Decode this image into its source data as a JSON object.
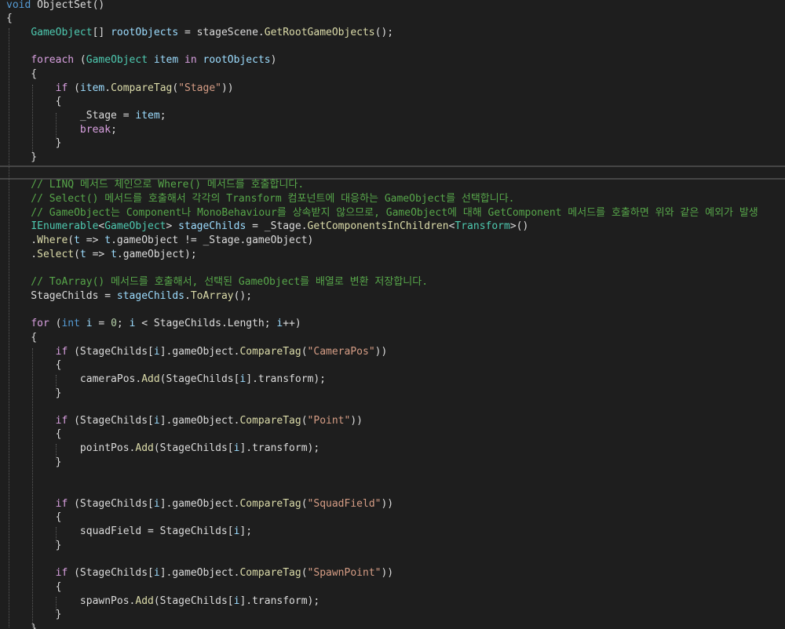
{
  "editor": {
    "language": "C#",
    "colors": {
      "background": "#1e1e1e",
      "keyword": "#569cd6",
      "control": "#d8a0df",
      "type": "#4ec9b0",
      "method": "#dcdcaa",
      "string": "#d69d85",
      "number": "#b5cea8",
      "local": "#9cdcfe",
      "comment": "#57a64a",
      "plain": "#dcdcdc"
    },
    "lines": [
      {
        "tokens": [
          {
            "t": "void",
            "c": "kw"
          },
          {
            "t": " ObjectSet()",
            "c": "txt"
          }
        ]
      },
      {
        "tokens": [
          {
            "t": "{",
            "c": "txt"
          }
        ]
      },
      {
        "tokens": [
          {
            "t": "    ",
            "c": "txt"
          },
          {
            "t": "GameObject",
            "c": "type"
          },
          {
            "t": "[] ",
            "c": "txt"
          },
          {
            "t": "rootObjects",
            "c": "var"
          },
          {
            "t": " = stageScene.",
            "c": "txt"
          },
          {
            "t": "GetRootGameObjects",
            "c": "fn"
          },
          {
            "t": "();",
            "c": "txt"
          }
        ]
      },
      {
        "tokens": []
      },
      {
        "tokens": [
          {
            "t": "    ",
            "c": "txt"
          },
          {
            "t": "foreach",
            "c": "ctl"
          },
          {
            "t": " (",
            "c": "txt"
          },
          {
            "t": "GameObject",
            "c": "type"
          },
          {
            "t": " ",
            "c": "txt"
          },
          {
            "t": "item",
            "c": "var"
          },
          {
            "t": " ",
            "c": "txt"
          },
          {
            "t": "in",
            "c": "ctl"
          },
          {
            "t": " ",
            "c": "txt"
          },
          {
            "t": "rootObjects",
            "c": "var"
          },
          {
            "t": ")",
            "c": "txt"
          }
        ]
      },
      {
        "tokens": [
          {
            "t": "    {",
            "c": "txt"
          }
        ]
      },
      {
        "tokens": [
          {
            "t": "        ",
            "c": "txt"
          },
          {
            "t": "if",
            "c": "ctl"
          },
          {
            "t": " (",
            "c": "txt"
          },
          {
            "t": "item",
            "c": "var"
          },
          {
            "t": ".",
            "c": "txt"
          },
          {
            "t": "CompareTag",
            "c": "fn"
          },
          {
            "t": "(",
            "c": "txt"
          },
          {
            "t": "\"Stage\"",
            "c": "str"
          },
          {
            "t": "))",
            "c": "txt"
          }
        ]
      },
      {
        "tokens": [
          {
            "t": "        {",
            "c": "txt"
          }
        ]
      },
      {
        "tokens": [
          {
            "t": "            _Stage = ",
            "c": "txt"
          },
          {
            "t": "item",
            "c": "var"
          },
          {
            "t": ";",
            "c": "txt"
          }
        ]
      },
      {
        "tokens": [
          {
            "t": "            ",
            "c": "txt"
          },
          {
            "t": "break",
            "c": "ctl"
          },
          {
            "t": ";",
            "c": "txt"
          }
        ]
      },
      {
        "tokens": [
          {
            "t": "        }",
            "c": "txt"
          }
        ]
      },
      {
        "tokens": [
          {
            "t": "    }",
            "c": "txt"
          }
        ]
      },
      {
        "tokens": []
      },
      {
        "tokens": [
          {
            "t": "    // LINQ 메서드 체인으로 Where() 메서드를 호출합니다.",
            "c": "com"
          }
        ]
      },
      {
        "tokens": [
          {
            "t": "    // Select() 메서드를 호출해서 각각의 Transform 컴포넌트에 대응하는 GameObject를 선택합니다.",
            "c": "com"
          }
        ]
      },
      {
        "tokens": [
          {
            "t": "    // GameObject는 Component나 MonoBehaviour를 상속받지 않으므로, GameObject에 대해 GetComponent 메서드를 호출하면 위와 같은 예외가 발생",
            "c": "com"
          }
        ]
      },
      {
        "tokens": [
          {
            "t": "    ",
            "c": "txt"
          },
          {
            "t": "IEnumerable",
            "c": "type"
          },
          {
            "t": "<",
            "c": "txt"
          },
          {
            "t": "GameObject",
            "c": "type"
          },
          {
            "t": "> ",
            "c": "txt"
          },
          {
            "t": "stageChilds",
            "c": "var"
          },
          {
            "t": " = _Stage.",
            "c": "txt"
          },
          {
            "t": "GetComponentsInChildren",
            "c": "fn"
          },
          {
            "t": "<",
            "c": "txt"
          },
          {
            "t": "Transform",
            "c": "type"
          },
          {
            "t": ">()",
            "c": "txt"
          }
        ]
      },
      {
        "tokens": [
          {
            "t": "    .",
            "c": "txt"
          },
          {
            "t": "Where",
            "c": "fn"
          },
          {
            "t": "(",
            "c": "txt"
          },
          {
            "t": "t",
            "c": "var"
          },
          {
            "t": " => ",
            "c": "txt"
          },
          {
            "t": "t",
            "c": "var"
          },
          {
            "t": ".gameObject != _Stage.gameObject)",
            "c": "txt"
          }
        ]
      },
      {
        "tokens": [
          {
            "t": "    .",
            "c": "txt"
          },
          {
            "t": "Select",
            "c": "fn"
          },
          {
            "t": "(",
            "c": "txt"
          },
          {
            "t": "t",
            "c": "var"
          },
          {
            "t": " => ",
            "c": "txt"
          },
          {
            "t": "t",
            "c": "var"
          },
          {
            "t": ".gameObject);",
            "c": "txt"
          }
        ]
      },
      {
        "tokens": []
      },
      {
        "tokens": [
          {
            "t": "    // ToArray() 메서드를 호출해서, 선택된 GameObject를 배열로 변환 저장합니다.",
            "c": "com"
          }
        ]
      },
      {
        "tokens": [
          {
            "t": "    StageChilds = ",
            "c": "txt"
          },
          {
            "t": "stageChilds",
            "c": "var"
          },
          {
            "t": ".",
            "c": "txt"
          },
          {
            "t": "ToArray",
            "c": "fn"
          },
          {
            "t": "();",
            "c": "txt"
          }
        ]
      },
      {
        "tokens": []
      },
      {
        "tokens": [
          {
            "t": "    ",
            "c": "txt"
          },
          {
            "t": "for",
            "c": "ctl"
          },
          {
            "t": " (",
            "c": "txt"
          },
          {
            "t": "int",
            "c": "kw"
          },
          {
            "t": " ",
            "c": "txt"
          },
          {
            "t": "i",
            "c": "var"
          },
          {
            "t": " = ",
            "c": "txt"
          },
          {
            "t": "0",
            "c": "num"
          },
          {
            "t": "; ",
            "c": "txt"
          },
          {
            "t": "i",
            "c": "var"
          },
          {
            "t": " < StageChilds.Length; ",
            "c": "txt"
          },
          {
            "t": "i",
            "c": "var"
          },
          {
            "t": "++)",
            "c": "txt"
          }
        ]
      },
      {
        "tokens": [
          {
            "t": "    {",
            "c": "txt"
          }
        ]
      },
      {
        "tokens": [
          {
            "t": "        ",
            "c": "txt"
          },
          {
            "t": "if",
            "c": "ctl"
          },
          {
            "t": " (StageChilds[",
            "c": "txt"
          },
          {
            "t": "i",
            "c": "var"
          },
          {
            "t": "].gameObject.",
            "c": "txt"
          },
          {
            "t": "CompareTag",
            "c": "fn"
          },
          {
            "t": "(",
            "c": "txt"
          },
          {
            "t": "\"CameraPos\"",
            "c": "str"
          },
          {
            "t": "))",
            "c": "txt"
          }
        ]
      },
      {
        "tokens": [
          {
            "t": "        {",
            "c": "txt"
          }
        ]
      },
      {
        "tokens": [
          {
            "t": "            cameraPos.",
            "c": "txt"
          },
          {
            "t": "Add",
            "c": "fn"
          },
          {
            "t": "(StageChilds[",
            "c": "txt"
          },
          {
            "t": "i",
            "c": "var"
          },
          {
            "t": "].transform);",
            "c": "txt"
          }
        ]
      },
      {
        "tokens": [
          {
            "t": "        }",
            "c": "txt"
          }
        ]
      },
      {
        "tokens": []
      },
      {
        "tokens": [
          {
            "t": "        ",
            "c": "txt"
          },
          {
            "t": "if",
            "c": "ctl"
          },
          {
            "t": " (StageChilds[",
            "c": "txt"
          },
          {
            "t": "i",
            "c": "var"
          },
          {
            "t": "].gameObject.",
            "c": "txt"
          },
          {
            "t": "CompareTag",
            "c": "fn"
          },
          {
            "t": "(",
            "c": "txt"
          },
          {
            "t": "\"Point\"",
            "c": "str"
          },
          {
            "t": "))",
            "c": "txt"
          }
        ]
      },
      {
        "tokens": [
          {
            "t": "        {",
            "c": "txt"
          }
        ]
      },
      {
        "tokens": [
          {
            "t": "            pointPos.",
            "c": "txt"
          },
          {
            "t": "Add",
            "c": "fn"
          },
          {
            "t": "(StageChilds[",
            "c": "txt"
          },
          {
            "t": "i",
            "c": "var"
          },
          {
            "t": "].transform);",
            "c": "txt"
          }
        ]
      },
      {
        "tokens": [
          {
            "t": "        }",
            "c": "txt"
          }
        ]
      },
      {
        "tokens": []
      },
      {
        "tokens": []
      },
      {
        "tokens": [
          {
            "t": "        ",
            "c": "txt"
          },
          {
            "t": "if",
            "c": "ctl"
          },
          {
            "t": " (StageChilds[",
            "c": "txt"
          },
          {
            "t": "i",
            "c": "var"
          },
          {
            "t": "].gameObject.",
            "c": "txt"
          },
          {
            "t": "CompareTag",
            "c": "fn"
          },
          {
            "t": "(",
            "c": "txt"
          },
          {
            "t": "\"SquadField\"",
            "c": "str"
          },
          {
            "t": "))",
            "c": "txt"
          }
        ]
      },
      {
        "tokens": [
          {
            "t": "        {",
            "c": "txt"
          }
        ]
      },
      {
        "tokens": [
          {
            "t": "            squadField = StageChilds[",
            "c": "txt"
          },
          {
            "t": "i",
            "c": "var"
          },
          {
            "t": "];",
            "c": "txt"
          }
        ]
      },
      {
        "tokens": [
          {
            "t": "        }",
            "c": "txt"
          }
        ]
      },
      {
        "tokens": []
      },
      {
        "tokens": [
          {
            "t": "        ",
            "c": "txt"
          },
          {
            "t": "if",
            "c": "ctl"
          },
          {
            "t": " (StageChilds[",
            "c": "txt"
          },
          {
            "t": "i",
            "c": "var"
          },
          {
            "t": "].gameObject.",
            "c": "txt"
          },
          {
            "t": "CompareTag",
            "c": "fn"
          },
          {
            "t": "(",
            "c": "txt"
          },
          {
            "t": "\"SpawnPoint\"",
            "c": "str"
          },
          {
            "t": "))",
            "c": "txt"
          }
        ]
      },
      {
        "tokens": [
          {
            "t": "        {",
            "c": "txt"
          }
        ]
      },
      {
        "tokens": [
          {
            "t": "            spawnPos.",
            "c": "txt"
          },
          {
            "t": "Add",
            "c": "fn"
          },
          {
            "t": "(StageChilds[",
            "c": "txt"
          },
          {
            "t": "i",
            "c": "var"
          },
          {
            "t": "].transform);",
            "c": "txt"
          }
        ]
      },
      {
        "tokens": [
          {
            "t": "        }",
            "c": "txt"
          }
        ]
      },
      {
        "tokens": [
          {
            "t": "    }",
            "c": "txt"
          }
        ]
      }
    ]
  }
}
